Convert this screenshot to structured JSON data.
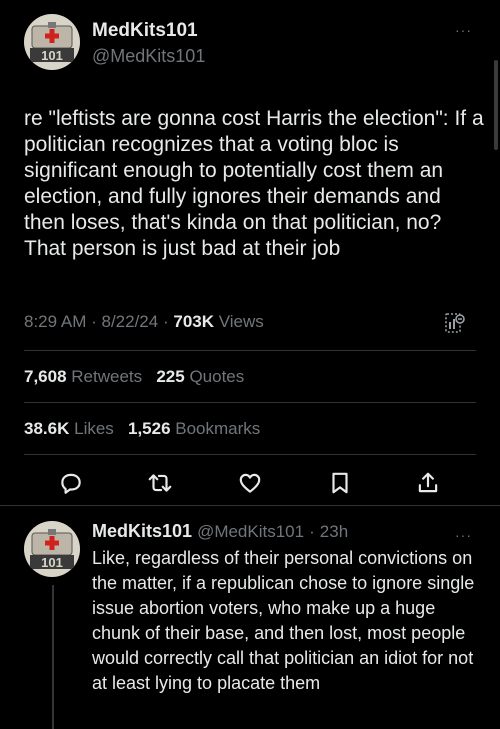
{
  "post": {
    "author_name": "MedKits101",
    "author_handle": "@MedKits101",
    "text": "re \"leftists are gonna cost Harris the election\": If a politician recognizes that a voting bloc is significant enough to potentially cost them an election, and fully ignores their demands and then loses, that's kinda on that politician, no? That person is just bad at their job",
    "time": "8:29 AM",
    "date": "8/22/24",
    "views_count": "703K",
    "views_label": "Views",
    "retweets_count": "7,608",
    "retweets_label": "Retweets",
    "quotes_count": "225",
    "quotes_label": "Quotes",
    "likes_count": "38.6K",
    "likes_label": "Likes",
    "bookmarks_count": "1,526",
    "bookmarks_label": "Bookmarks",
    "more_label": "···"
  },
  "reply": {
    "author_name": "MedKits101",
    "author_handle": "@MedKits101",
    "age": "23h",
    "text": "Like, regardless of their personal convictions on the matter, if a republican chose to ignore single issue abortion voters, who make up a huge chunk of their base, and then lost, most people would correctly call that politician an idiot for not at least lying to placate them",
    "more_label": "···"
  },
  "icons": {
    "reply": "comment-icon",
    "retweet": "retweet-icon",
    "like": "heart-icon",
    "bookmark": "bookmark-icon",
    "share": "share-icon",
    "analytics": "analytics-icon"
  },
  "colors": {
    "background": "#000000",
    "text": "#e7e9ea",
    "secondary": "#71767b",
    "divider": "#2f3336"
  }
}
